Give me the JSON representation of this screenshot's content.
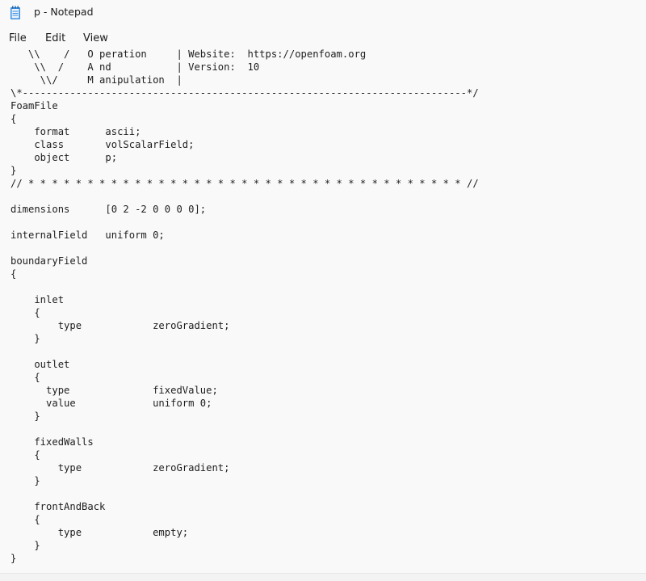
{
  "window": {
    "title": "p - Notepad",
    "icon": "notepad-icon"
  },
  "menu": {
    "file": "File",
    "edit": "Edit",
    "view": "View"
  },
  "editor": {
    "lines": [
      "   \\\\    /   O peration     | Website:  https://openfoam.org",
      "    \\\\  /    A nd           | Version:  10",
      "     \\\\/     M anipulation  |",
      "\\*---------------------------------------------------------------------------*/",
      "FoamFile",
      "{",
      "    format      ascii;",
      "    class       volScalarField;",
      "    object      p;",
      "}",
      "// * * * * * * * * * * * * * * * * * * * * * * * * * * * * * * * * * * * * * //",
      "",
      "dimensions      [0 2 -2 0 0 0 0];",
      "",
      "internalField   uniform 0;",
      "",
      "boundaryField",
      "{",
      "",
      "    inlet",
      "    {",
      "        type            zeroGradient;",
      "    }",
      "",
      "    outlet",
      "    {",
      "      type              fixedValue;",
      "      value             uniform 0;",
      "    }",
      "",
      "    fixedWalls",
      "    {",
      "        type            zeroGradient;",
      "    }",
      "",
      "    frontAndBack",
      "    {",
      "        type            empty;",
      "    }",
      "}"
    ]
  }
}
